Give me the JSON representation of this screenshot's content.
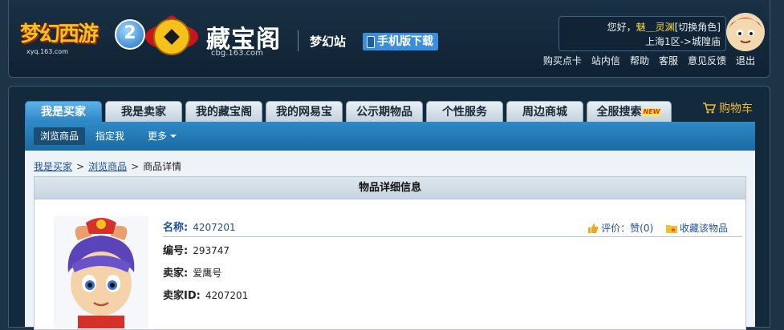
{
  "header": {
    "game_logo_text": "梦幻西游",
    "game_logo_number": "2",
    "game_logo_url": "xyq.163.com",
    "cbg_title": "藏宝阁",
    "cbg_domain": "cbg.163.com",
    "site_name": "梦幻站",
    "mobile_download": "手机版下载",
    "user": {
      "greeting": "您好，",
      "name": "魅＿灵渊",
      "switch_role": "[切换角色]",
      "server": "上海1区->城隍庙"
    },
    "links": [
      "购买点卡",
      "站内信",
      "帮助",
      "客服",
      "意见反馈",
      "退出"
    ]
  },
  "tabs": [
    {
      "label": "我是买家",
      "active": true
    },
    {
      "label": "我是卖家",
      "active": false
    },
    {
      "label": "我的藏宝阁",
      "active": false
    },
    {
      "label": "我的网易宝",
      "active": false
    },
    {
      "label": "公示期物品",
      "active": false
    },
    {
      "label": "个性服务",
      "active": false
    },
    {
      "label": "周边商城",
      "active": false
    },
    {
      "label": "全服搜索",
      "active": false,
      "badge": "NEW"
    }
  ],
  "cart_label": "购物车",
  "subnav": {
    "browse": "浏览商品",
    "assigned": "指定我",
    "more": "更多"
  },
  "breadcrumb": {
    "home": "我是买家",
    "browse": "浏览商品",
    "current": "商品详情",
    "separator": ">"
  },
  "detail": {
    "title": "物品详细信息",
    "name_label": "名称:",
    "name_value": "4207201",
    "rating": "评价：赞(0)",
    "favorite": "收藏该物品",
    "rows": [
      {
        "label": "编号:",
        "value": "293747"
      },
      {
        "label": "卖家:",
        "value": "爱鹰号"
      },
      {
        "label": "卖家ID:",
        "value": "4207201"
      }
    ]
  },
  "colors": {
    "background": "#1d3447",
    "accent": "#2c83c4",
    "link": "#1f4f9c",
    "username": "#f6d64a",
    "cart": "#f4b82e"
  }
}
